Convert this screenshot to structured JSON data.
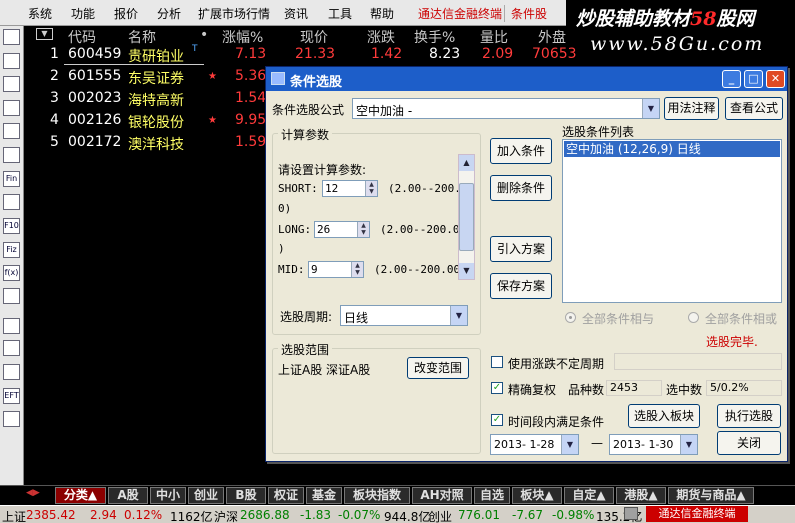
{
  "menu": {
    "items": [
      "系统",
      "功能",
      "报价",
      "分析",
      "扩展市场行情",
      "资讯",
      "工具",
      "帮助"
    ],
    "promo": "通达信金融终端",
    "cond_menu": "条件股"
  },
  "watermark": {
    "title_main": "炒股辅助教材",
    "title_num": "58",
    "title_tail": "股网",
    "url": "www.58Gu.com"
  },
  "left_toolbar": {
    "icons": [
      "kline-icon",
      "quote-list-icon",
      "grid-icon",
      "line-chart-icon",
      "bars-icon",
      "table-icon",
      "fin-icon",
      "doc-icon",
      "f10-icon",
      "fiz-icon",
      "fx-icon",
      "search-icon",
      "folder-icon",
      "sort-icon",
      "clock-icon",
      "eft-icon",
      "print-icon"
    ],
    "labels": [
      "",
      "",
      "",
      "",
      "",
      "",
      "Fin",
      "",
      "F10",
      "Fiz",
      "f(x)",
      "",
      "",
      "",
      "",
      "EFT",
      ""
    ]
  },
  "stock_table": {
    "headers": {
      "code": "代码",
      "name": "名称",
      "dot": "•",
      "change_pct": "涨幅%",
      "price": "现价",
      "change": "涨跌",
      "turnover": "换手%",
      "ratio": "量比",
      "outer": "外盘"
    },
    "rows": [
      {
        "idx": "1",
        "code": "600459",
        "name": "贵研铂业",
        "mark": "T",
        "star": "",
        "chg": "7.13",
        "price": "21.33",
        "change": "1.42",
        "turnover": "8.23",
        "ratio": "2.09",
        "outer": "70653"
      },
      {
        "idx": "2",
        "code": "601555",
        "name": "东吴证券",
        "mark": "",
        "star": "★",
        "chg": "5.36"
      },
      {
        "idx": "3",
        "code": "002023",
        "name": "海特高新",
        "mark": "",
        "star": "",
        "chg": "1.54"
      },
      {
        "idx": "4",
        "code": "002126",
        "name": "银轮股份",
        "mark": "",
        "star": "★",
        "chg": "9.95"
      },
      {
        "idx": "5",
        "code": "002172",
        "name": "澳洋科技",
        "mark": "",
        "star": "",
        "chg": "1.59"
      }
    ]
  },
  "dialog": {
    "title": "条件选股",
    "formula_label": "条件选股公式",
    "formula_value": "空中加油 -",
    "btn_usage": "用法注释",
    "btn_view": "查看公式",
    "group_params": "计算参数",
    "param_prompt": "请设置计算参数:",
    "params": {
      "short": {
        "label": "SHORT:",
        "value": "12",
        "range_a": "(2.00--200.0",
        "range_b": "0)"
      },
      "long": {
        "label": "LONG:",
        "value": "26",
        "range_a": "(2.00--200.00",
        "range_b": ")"
      },
      "mid": {
        "label": "MID:",
        "value": "9",
        "range_a": "(2.00--200.00)"
      }
    },
    "btn_add": "加入条件",
    "btn_del": "删除条件",
    "btn_load": "引入方案",
    "btn_save": "保存方案",
    "list_label": "选股条件列表",
    "list_item": "空中加油 (12,26,9) 日线",
    "radio_and": "全部条件相与",
    "radio_or": "全部条件相或",
    "period_label": "选股周期:",
    "period_value": "日线",
    "done_text": "选股完毕.",
    "group_range": "选股范围",
    "range_text": "上证A股 深证A股",
    "btn_change_range": "改变范围",
    "chk_irregular": "使用涨跌不定周期",
    "chk_precise": "精确复权",
    "count_label": "品种数",
    "count_value": "2453",
    "sel_label": "选中数",
    "sel_value": "5/0.2%",
    "chk_time": "时间段内满足条件",
    "btn_to_block": "选股入板块",
    "btn_execute": "执行选股",
    "date_from": "2013- 1-28",
    "date_sep": "—",
    "date_to": "2013- 1-30",
    "btn_close": "关闭"
  },
  "tabs": [
    "分类▲",
    "A股",
    "中小",
    "创业",
    "B股",
    "权证",
    "基金",
    "板块指数",
    "AH对照",
    "自选",
    "板块▲",
    "自定▲",
    "港股▲",
    "期货与商品▲"
  ],
  "statusbar": {
    "sh_label": "上证",
    "sh_value": "2385.42",
    "sh_change": "2.94",
    "sh_pct": "0.12%",
    "sh_amount": "1162亿",
    "hs_label": "沪深",
    "hs_value": "2686.88",
    "hs_change": "-1.83",
    "hs_pct": "-0.07%",
    "hs_amount": "944.8亿",
    "cy_label": "创业",
    "cy_value": "776.01",
    "cy_change": "-7.67",
    "cy_pct": "-0.98%",
    "cy_amount": "135.2亿",
    "ad_text": "通达信金融终端"
  }
}
